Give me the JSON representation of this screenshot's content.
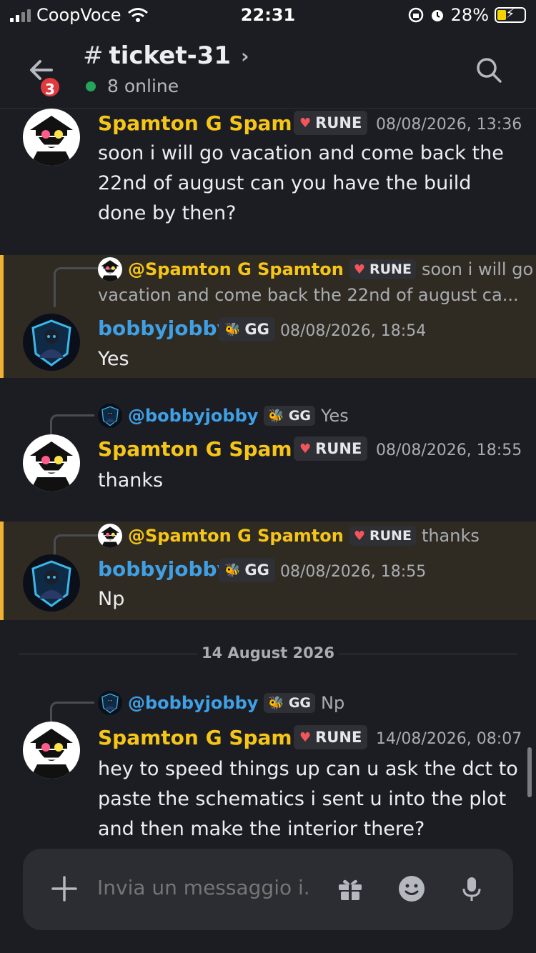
{
  "status": {
    "carrier": "CoopVoce",
    "time": "22:31",
    "battery": "28%"
  },
  "header": {
    "channel": "ticket-31",
    "badge": "3",
    "online": "8 online"
  },
  "messages": [
    {
      "author": "Spamton G Spam...",
      "tag": "RUNE",
      "time": "08/08/2026, 13:36",
      "text": "soon i will go vacation and come back the 22nd of august can you have the build done by then?"
    },
    {
      "reply_author": "@Spamton G Spamton",
      "reply_tag": "RUNE",
      "reply_text": "soon i will go",
      "reply_text2": "vacation and come back the 22nd of august ca...",
      "author": "bobbyjobby",
      "tag": "GG",
      "time": "08/08/2026, 18:54",
      "text": "Yes"
    },
    {
      "reply_author": "@bobbyjobby",
      "reply_tag": "GG",
      "reply_text": "Yes",
      "author": "Spamton G Spam...",
      "tag": "RUNE",
      "time": "08/08/2026, 18:55",
      "text": "thanks"
    },
    {
      "reply_author": "@Spamton G Spamton",
      "reply_tag": "RUNE",
      "reply_text": "thanks",
      "author": "bobbyjobby",
      "tag": "GG",
      "time": "08/08/2026, 18:55",
      "text": "Np"
    },
    {
      "reply_author": "@bobbyjobby",
      "reply_tag": "GG",
      "reply_text": "Np",
      "author": "Spamton G Spam...",
      "tag": "RUNE",
      "time": "14/08/2026, 08:07",
      "text": "hey to speed things up can u ask the dct to paste the schematics i sent u into the plot and then make the interior there?"
    }
  ],
  "divider": "14 August 2026",
  "composer": {
    "placeholder": "Invia un messaggio i..."
  },
  "colors": {
    "background": "#1c1d22",
    "highlight": "#302b22",
    "highlight_bar": "#f0b232",
    "yellow_name": "#f5c518",
    "blue_name": "#3fa0e6",
    "online": "#23a55a",
    "badge": "#e0393e"
  }
}
